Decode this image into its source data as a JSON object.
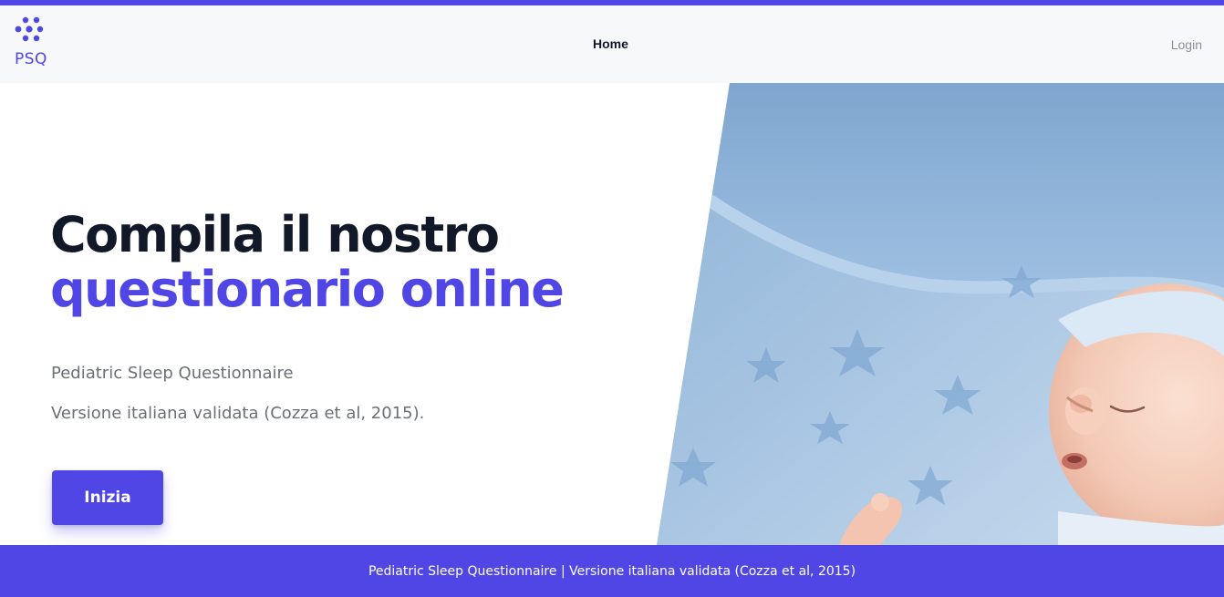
{
  "colors": {
    "accent": "#4f46e5",
    "heading": "#111827",
    "muted": "#6b6f76",
    "header_bg": "#f7f8fa"
  },
  "header": {
    "logo_text": "PSQ",
    "logo_icon": "dots-cluster-icon",
    "nav_home": "Home",
    "nav_login": "Login"
  },
  "hero": {
    "headline_line1": "Compila il nostro",
    "headline_line2": "questionario online",
    "subtitle": "Pediatric Sleep Questionnaire",
    "version_text": "Versione italiana validata (Cozza et al, 2015).",
    "cta_label": "Inizia",
    "image_icon": "sleeping-baby-photo"
  },
  "footer": {
    "text": "Pediatric Sleep Questionnaire | Versione italiana validata (Cozza et al, 2015)"
  }
}
